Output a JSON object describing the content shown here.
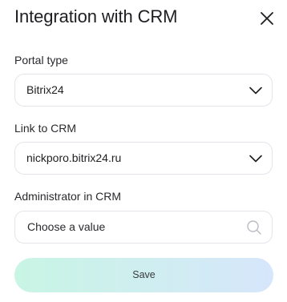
{
  "dialog": {
    "title": "Integration with CRM",
    "close_icon": "close-icon"
  },
  "portal_type": {
    "label": "Portal type",
    "value": "Bitrix24",
    "icon": "chevron-down-icon"
  },
  "crm_link": {
    "label": "Link to CRM",
    "value": "nickporo.bitrix24.ru",
    "icon": "chevron-down-icon"
  },
  "administrator": {
    "label": "Administrator in CRM",
    "placeholder": "Choose a value",
    "icon": "search-icon"
  },
  "actions": {
    "save_label": "Save"
  },
  "colors": {
    "save_gradient_start": "#c8f5e4",
    "save_gradient_end": "#d6e6fb",
    "field_border": "#e3e5ea"
  }
}
